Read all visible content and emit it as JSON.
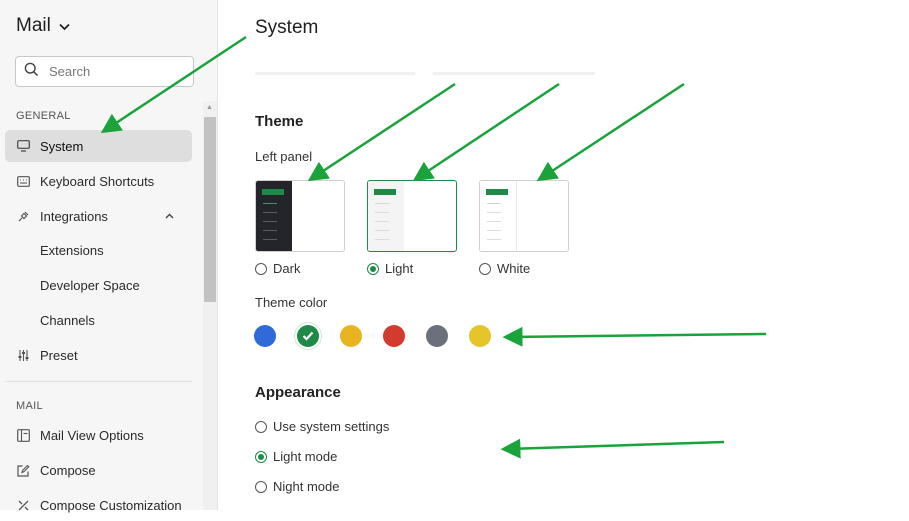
{
  "app": {
    "title": "Mail"
  },
  "search": {
    "placeholder": "Search"
  },
  "sidebar": {
    "general_label": "GENERAL",
    "mail_label": "MAIL",
    "items": [
      {
        "label": "System",
        "icon": "monitor-icon"
      },
      {
        "label": "Keyboard Shortcuts",
        "icon": "keyboard-icon"
      },
      {
        "label": "Integrations",
        "icon": "plug-icon"
      },
      {
        "label": "Extensions"
      },
      {
        "label": "Developer Space"
      },
      {
        "label": "Channels"
      },
      {
        "label": "Preset",
        "icon": "sliders-icon"
      },
      {
        "label": "Mail View Options",
        "icon": "layout-icon"
      },
      {
        "label": "Compose",
        "icon": "edit-icon"
      },
      {
        "label": "Compose Customization",
        "icon": "tools-icon"
      }
    ]
  },
  "main": {
    "title": "System",
    "theme": {
      "heading": "Theme",
      "left_panel_label": "Left panel",
      "panel_options": [
        {
          "label": "Dark",
          "selected": false
        },
        {
          "label": "Light",
          "selected": true
        },
        {
          "label": "White",
          "selected": false
        }
      ],
      "theme_color_label": "Theme color",
      "colors": [
        "#2f6bd8",
        "#1d8a45",
        "#e8b421",
        "#d33b2c",
        "#6b717c",
        "#e5c52a"
      ],
      "selected_color": "#1d8a45"
    },
    "appearance": {
      "heading": "Appearance",
      "options": [
        {
          "label": "Use system settings",
          "selected": false
        },
        {
          "label": "Light mode",
          "selected": true
        },
        {
          "label": "Night mode",
          "selected": false
        }
      ]
    }
  },
  "colors": {
    "accent": "#1d8a45",
    "annotation_arrow": "#1aa33a",
    "sidebar_bg": "#f6f6f6"
  }
}
